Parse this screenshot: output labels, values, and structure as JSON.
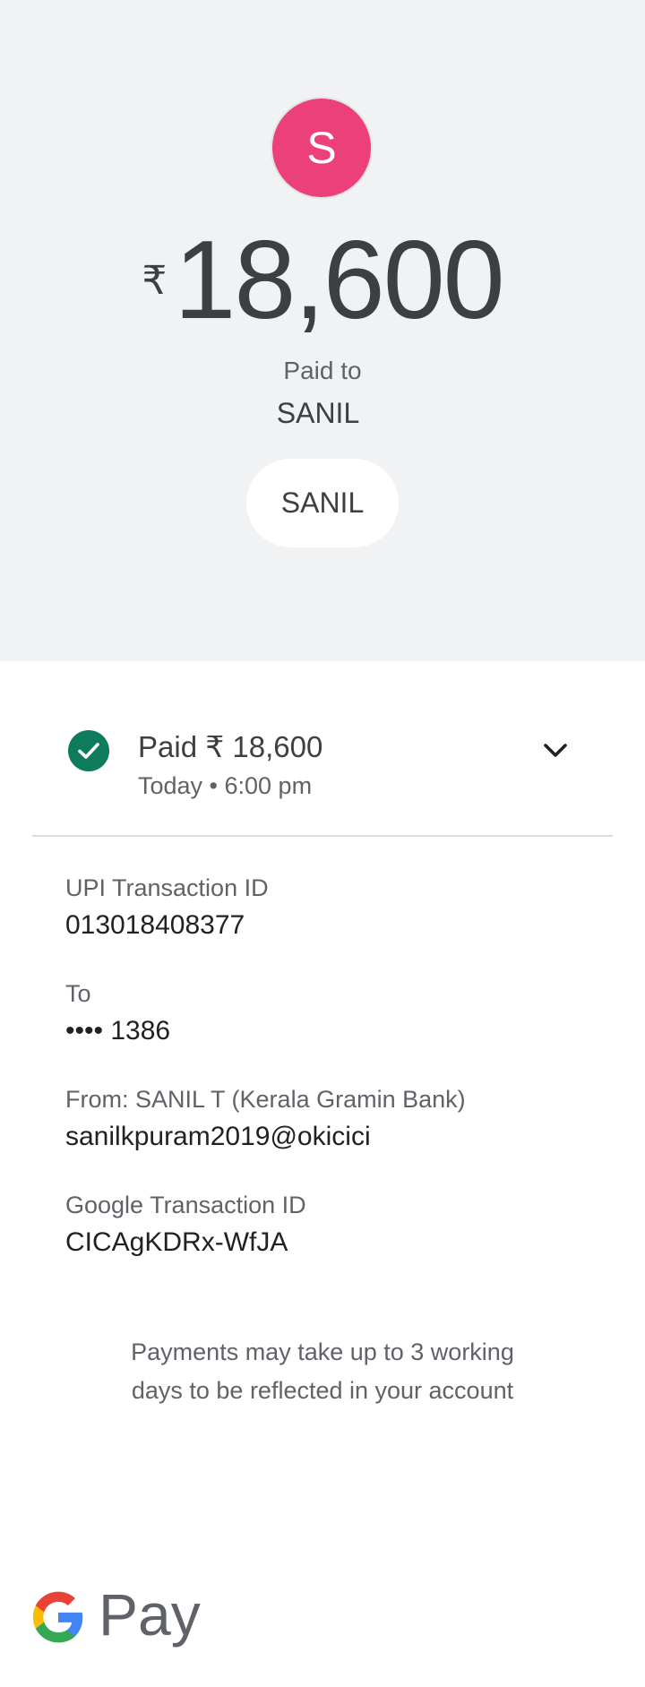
{
  "header": {
    "avatar_letter": "S",
    "avatar_color": "#ec407a",
    "currency_symbol": "₹",
    "amount": "18,600",
    "paid_to_label": "Paid to",
    "payee_name": "SANIL",
    "payee_chip_label": "SANIL"
  },
  "status": {
    "icon": "check-circle-icon",
    "icon_color": "#0f7b5d",
    "title": "Paid ₹ 18,600",
    "subtitle": "Today • 6:00 pm",
    "expand_icon": "chevron-down-icon"
  },
  "details": [
    {
      "label": "UPI Transaction ID",
      "value": "013018408377"
    },
    {
      "label": "To",
      "value": "•••• 1386"
    },
    {
      "label": "From: SANIL T (Kerala Gramin Bank)",
      "value": "sanilkpuram2019@okicici"
    },
    {
      "label": "Google Transaction ID",
      "value": "CICAgKDRx-WfJA"
    }
  ],
  "note": "Payments may take up to 3 working days to be reflected in your account",
  "footer": {
    "logo_icon": "google-g-icon",
    "brand_text": "Pay"
  }
}
